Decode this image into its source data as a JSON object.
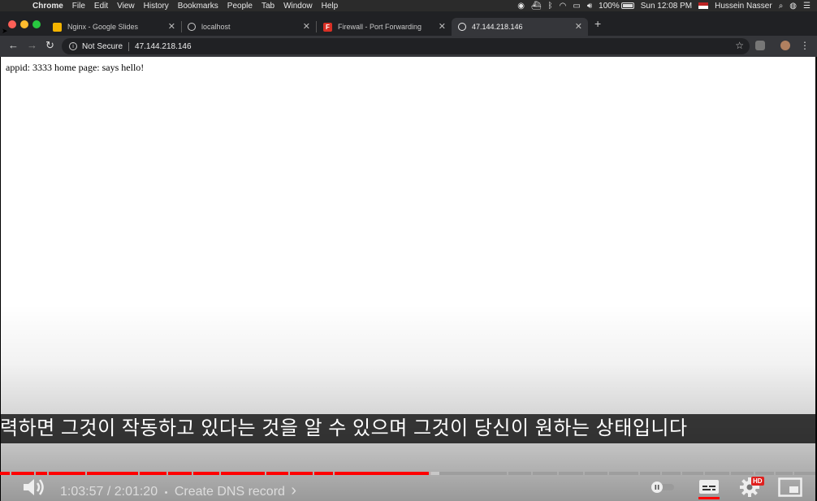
{
  "menubar": {
    "app": "Chrome",
    "items": [
      "File",
      "Edit",
      "View",
      "History",
      "Bookmarks",
      "People",
      "Tab",
      "Window",
      "Help"
    ],
    "battery": "100%",
    "clock": "Sun 12:08 PM",
    "user": "Hussein Nasser"
  },
  "tabs": [
    {
      "title": "Nginx - Google Slides",
      "favicon": "google-slides-icon",
      "color": "#f4b400"
    },
    {
      "title": "localhost",
      "favicon": "globe-icon"
    },
    {
      "title": "Firewall - Port Forwarding",
      "favicon": "firewall-icon",
      "favicon_text": "F",
      "color": "#d93025"
    },
    {
      "title": "47.144.218.146",
      "favicon": "globe-icon",
      "active": true
    }
  ],
  "toolbar": {
    "security": "Not Secure",
    "url": "47.144.218.146"
  },
  "page": {
    "body_text": "appid: 3333 home page: says hello!"
  },
  "video": {
    "caption": "력하면 그것이 작동하고 있다는 것을 알 수 있으며 그것이 당신이 원하는 상태입니다",
    "current_time": "1:03:57",
    "duration": "2:01:20",
    "time_display": "1:03:57 / 2:01:20",
    "separator": "•",
    "chapter": "Create DNS record",
    "chevron": "›",
    "progress_fraction": 0.527,
    "quality_badge": "HD",
    "colors": {
      "played": "#ff0000",
      "buffered": "#c8c8c8",
      "unplayed": "#9e9e9e"
    }
  }
}
